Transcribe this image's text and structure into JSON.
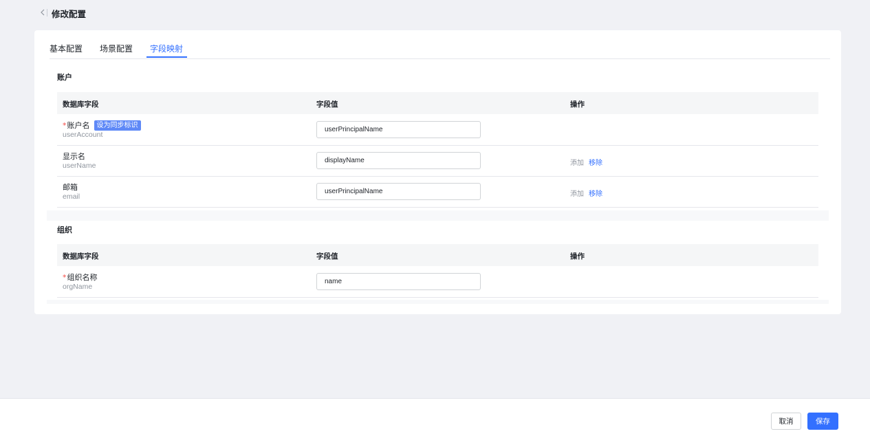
{
  "header": {
    "title": "修改配置"
  },
  "tabs": [
    {
      "label": "基本配置"
    },
    {
      "label": "场景配置"
    },
    {
      "label": "字段映射"
    }
  ],
  "sections": [
    {
      "title": "账户",
      "columns": [
        "数据库字段",
        "字段值",
        "操作"
      ],
      "rows": [
        {
          "label": "账户名",
          "required": true,
          "tag": "设为同步标识",
          "key": "userAccount",
          "value": "userPrincipalName"
        },
        {
          "label": "显示名",
          "required": false,
          "key": "userName",
          "value": "displayName",
          "add": "添加",
          "remove": "移除"
        },
        {
          "label": "邮箱",
          "required": false,
          "key": "email",
          "value": "userPrincipalName",
          "add": "添加",
          "remove": "移除"
        }
      ]
    },
    {
      "title": "组织",
      "columns": [
        "数据库字段",
        "字段值",
        "操作"
      ],
      "rows": [
        {
          "label": "组织名称",
          "required": true,
          "key": "orgName",
          "value": "name"
        }
      ]
    }
  ],
  "required_mark": "*",
  "footer": {
    "cancel": "取消",
    "save": "保存"
  }
}
